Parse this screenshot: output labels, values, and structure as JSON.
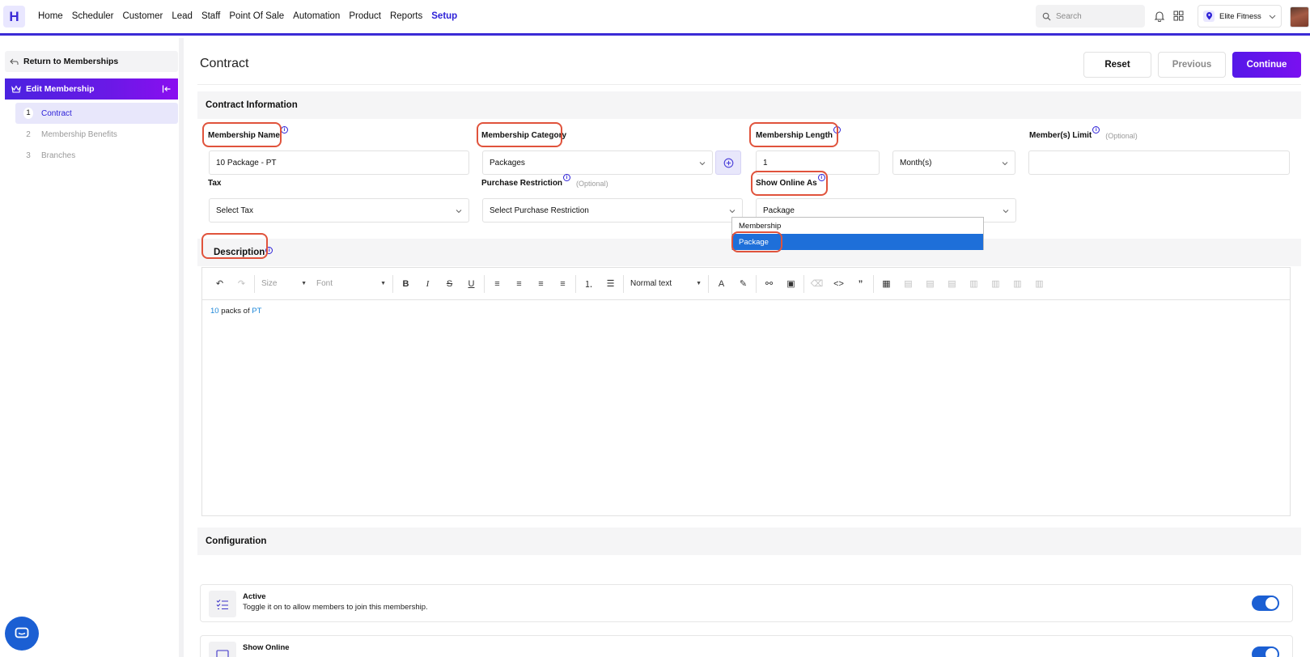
{
  "nav": {
    "logo": "H",
    "items": [
      "Home",
      "Scheduler",
      "Customer",
      "Lead",
      "Staff",
      "Point Of Sale",
      "Automation",
      "Product",
      "Reports",
      "Setup"
    ],
    "active": "Setup",
    "search_placeholder": "Search",
    "location": "Elite Fitness"
  },
  "sidebar": {
    "return_label": "Return to Memberships",
    "section_label": "Edit Membership",
    "steps": [
      {
        "num": "1",
        "label": "Contract"
      },
      {
        "num": "2",
        "label": "Membership Benefits"
      },
      {
        "num": "3",
        "label": "Branches"
      }
    ]
  },
  "header": {
    "title": "Contract",
    "reset": "Reset",
    "previous": "Previous",
    "continue": "Continue"
  },
  "contract_info": {
    "heading": "Contract Information",
    "membership_name": {
      "label": "Membership Name",
      "value": "10 Package - PT"
    },
    "membership_category": {
      "label": "Membership Category",
      "value": "Packages"
    },
    "membership_length": {
      "label": "Membership Length",
      "value": "1",
      "unit": "Month(s)"
    },
    "member_limit": {
      "label": "Member(s) Limit",
      "optional": "(Optional)",
      "value": ""
    },
    "tax": {
      "label": "Tax",
      "value": "Select Tax"
    },
    "purchase_restriction": {
      "label": "Purchase Restriction",
      "optional": "(Optional)",
      "value": "Select Purchase Restriction"
    },
    "show_online_as": {
      "label": "Show Online As",
      "value": "Package",
      "options": [
        "Membership",
        "Package"
      ]
    }
  },
  "description": {
    "heading": "Description",
    "toolbar": {
      "size": "Size",
      "font": "Font",
      "style": "Normal text"
    },
    "content": {
      "number": "10",
      "middle": " packs of ",
      "tail": "PT"
    }
  },
  "configuration": {
    "heading": "Configuration",
    "items": [
      {
        "title": "Active",
        "desc": "Toggle it on to allow members to join this membership.",
        "on": true
      },
      {
        "title": "Show Online",
        "desc": "",
        "on": true
      }
    ]
  },
  "colors": {
    "accent": "#2e22d8",
    "highlight": "#e0533c",
    "toggle": "#1b5fd3"
  }
}
